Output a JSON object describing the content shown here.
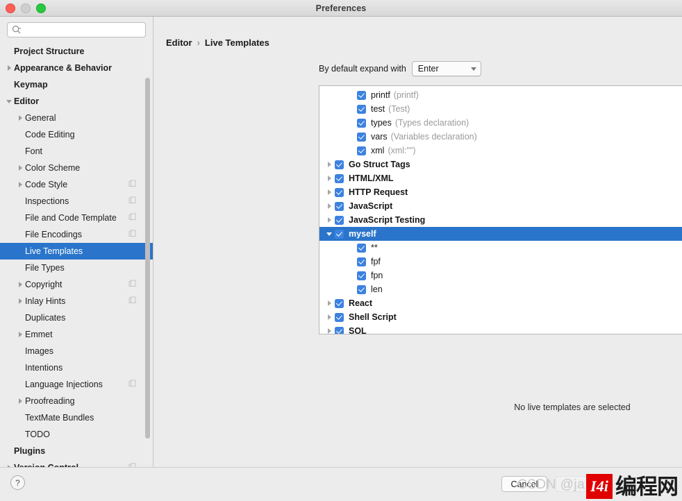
{
  "window": {
    "title": "Preferences",
    "traffic_lights": [
      "close",
      "minimize",
      "maximize"
    ]
  },
  "search": {
    "value": "",
    "placeholder": ""
  },
  "sidebar": {
    "items": [
      {
        "label": "Project Structure",
        "indent": 0,
        "arrow": "none",
        "bold": true,
        "selected": false,
        "badge": false
      },
      {
        "label": "Appearance & Behavior",
        "indent": 0,
        "arrow": "right",
        "bold": true,
        "selected": false,
        "badge": false
      },
      {
        "label": "Keymap",
        "indent": 0,
        "arrow": "none",
        "bold": true,
        "selected": false,
        "badge": false
      },
      {
        "label": "Editor",
        "indent": 0,
        "arrow": "down",
        "bold": true,
        "selected": false,
        "badge": false
      },
      {
        "label": "General",
        "indent": 1,
        "arrow": "right",
        "bold": false,
        "selected": false,
        "badge": false
      },
      {
        "label": "Code Editing",
        "indent": 1,
        "arrow": "none",
        "bold": false,
        "selected": false,
        "badge": false
      },
      {
        "label": "Font",
        "indent": 1,
        "arrow": "none",
        "bold": false,
        "selected": false,
        "badge": false
      },
      {
        "label": "Color Scheme",
        "indent": 1,
        "arrow": "right",
        "bold": false,
        "selected": false,
        "badge": false
      },
      {
        "label": "Code Style",
        "indent": 1,
        "arrow": "right",
        "bold": false,
        "selected": false,
        "badge": true
      },
      {
        "label": "Inspections",
        "indent": 1,
        "arrow": "none",
        "bold": false,
        "selected": false,
        "badge": true
      },
      {
        "label": "File and Code Template",
        "indent": 1,
        "arrow": "none",
        "bold": false,
        "selected": false,
        "badge": true
      },
      {
        "label": "File Encodings",
        "indent": 1,
        "arrow": "none",
        "bold": false,
        "selected": false,
        "badge": true
      },
      {
        "label": "Live Templates",
        "indent": 1,
        "arrow": "none",
        "bold": false,
        "selected": true,
        "badge": false
      },
      {
        "label": "File Types",
        "indent": 1,
        "arrow": "none",
        "bold": false,
        "selected": false,
        "badge": false
      },
      {
        "label": "Copyright",
        "indent": 1,
        "arrow": "right",
        "bold": false,
        "selected": false,
        "badge": true
      },
      {
        "label": "Inlay Hints",
        "indent": 1,
        "arrow": "right",
        "bold": false,
        "selected": false,
        "badge": true
      },
      {
        "label": "Duplicates",
        "indent": 1,
        "arrow": "none",
        "bold": false,
        "selected": false,
        "badge": false
      },
      {
        "label": "Emmet",
        "indent": 1,
        "arrow": "right",
        "bold": false,
        "selected": false,
        "badge": false
      },
      {
        "label": "Images",
        "indent": 1,
        "arrow": "none",
        "bold": false,
        "selected": false,
        "badge": false
      },
      {
        "label": "Intentions",
        "indent": 1,
        "arrow": "none",
        "bold": false,
        "selected": false,
        "badge": false
      },
      {
        "label": "Language Injections",
        "indent": 1,
        "arrow": "none",
        "bold": false,
        "selected": false,
        "badge": true
      },
      {
        "label": "Proofreading",
        "indent": 1,
        "arrow": "right",
        "bold": false,
        "selected": false,
        "badge": false
      },
      {
        "label": "TextMate Bundles",
        "indent": 1,
        "arrow": "none",
        "bold": false,
        "selected": false,
        "badge": false
      },
      {
        "label": "TODO",
        "indent": 1,
        "arrow": "none",
        "bold": false,
        "selected": false,
        "badge": false
      },
      {
        "label": "Plugins",
        "indent": 0,
        "arrow": "none",
        "bold": true,
        "selected": false,
        "badge": false
      },
      {
        "label": "Version Control",
        "indent": 0,
        "arrow": "right",
        "bold": true,
        "selected": false,
        "badge": true
      }
    ]
  },
  "main": {
    "breadcrumb": {
      "parent": "Editor",
      "separator": "›",
      "current": "Live Templates"
    },
    "expand_with": {
      "label": "By default expand with",
      "value": "Enter"
    },
    "empty_message": "No live templates are selected",
    "toolbar": {
      "add": "+",
      "remove": "−",
      "duplicate": "duplicate-icon",
      "revert": "revert-icon"
    },
    "templates": [
      {
        "label": "printf",
        "desc": "(printf)",
        "indent": 2,
        "arrow": "none",
        "checked": true,
        "group": false,
        "selected": false
      },
      {
        "label": "test",
        "desc": "(Test)",
        "indent": 2,
        "arrow": "none",
        "checked": true,
        "group": false,
        "selected": false
      },
      {
        "label": "types",
        "desc": "(Types declaration)",
        "indent": 2,
        "arrow": "none",
        "checked": true,
        "group": false,
        "selected": false
      },
      {
        "label": "vars",
        "desc": "(Variables declaration)",
        "indent": 2,
        "arrow": "none",
        "checked": true,
        "group": false,
        "selected": false
      },
      {
        "label": "xml",
        "desc": "(xml:\"\")",
        "indent": 2,
        "arrow": "none",
        "checked": true,
        "group": false,
        "selected": false
      },
      {
        "label": "Go Struct Tags",
        "desc": "",
        "indent": 0,
        "arrow": "right",
        "checked": true,
        "group": true,
        "selected": false
      },
      {
        "label": "HTML/XML",
        "desc": "",
        "indent": 0,
        "arrow": "right",
        "checked": true,
        "group": true,
        "selected": false
      },
      {
        "label": "HTTP Request",
        "desc": "",
        "indent": 0,
        "arrow": "right",
        "checked": true,
        "group": true,
        "selected": false
      },
      {
        "label": "JavaScript",
        "desc": "",
        "indent": 0,
        "arrow": "right",
        "checked": true,
        "group": true,
        "selected": false
      },
      {
        "label": "JavaScript Testing",
        "desc": "",
        "indent": 0,
        "arrow": "right",
        "checked": true,
        "group": true,
        "selected": false
      },
      {
        "label": "myself",
        "desc": "",
        "indent": 0,
        "arrow": "down",
        "checked": true,
        "group": true,
        "selected": true
      },
      {
        "label": "**",
        "desc": "",
        "indent": 2,
        "arrow": "none",
        "checked": true,
        "group": false,
        "selected": false
      },
      {
        "label": "fpf",
        "desc": "",
        "indent": 2,
        "arrow": "none",
        "checked": true,
        "group": false,
        "selected": false
      },
      {
        "label": "fpn",
        "desc": "",
        "indent": 2,
        "arrow": "none",
        "checked": true,
        "group": false,
        "selected": false
      },
      {
        "label": "len",
        "desc": "",
        "indent": 2,
        "arrow": "none",
        "checked": true,
        "group": false,
        "selected": false
      },
      {
        "label": "React",
        "desc": "",
        "indent": 0,
        "arrow": "right",
        "checked": true,
        "group": true,
        "selected": false
      },
      {
        "label": "Shell Script",
        "desc": "",
        "indent": 0,
        "arrow": "right",
        "checked": true,
        "group": true,
        "selected": false
      },
      {
        "label": "SQL",
        "desc": "",
        "indent": 0,
        "arrow": "right",
        "checked": true,
        "group": true,
        "selected": false
      }
    ]
  },
  "footer": {
    "help": "?",
    "cancel": "Cancel",
    "ok": ""
  },
  "watermark": {
    "text": "CSDN @ja",
    "logo_badge": "I4i",
    "logo_cn": "编程网"
  },
  "colors": {
    "selection_blue": "#2a75cb",
    "checkbox_blue": "#3c82e0",
    "window_bg": "#ececec",
    "list_bg": "#ffffff",
    "watermark_red": "#e00000"
  }
}
